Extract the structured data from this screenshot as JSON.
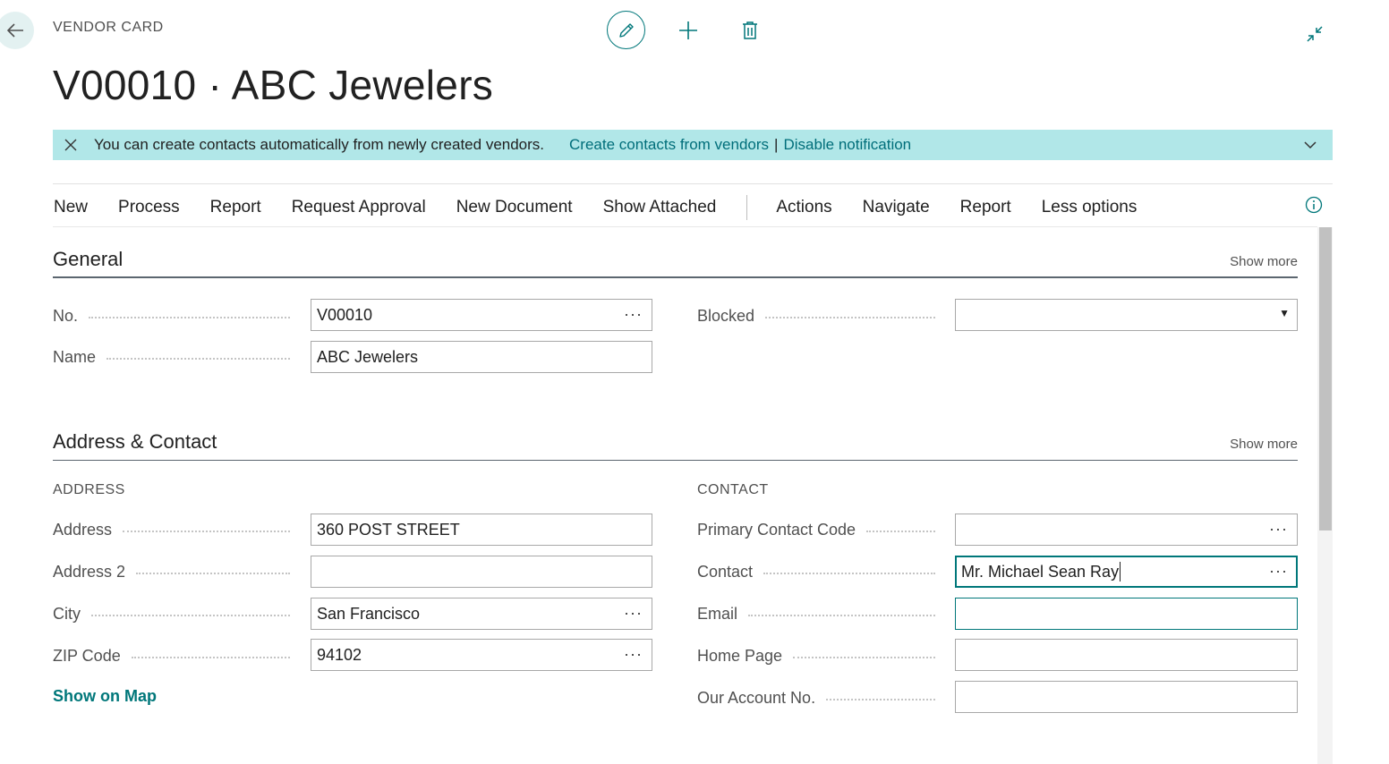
{
  "header": {
    "caption": "VENDOR CARD",
    "title": "V00010 · ABC Jewelers"
  },
  "notification": {
    "message": "You can create contacts automatically from newly created vendors.",
    "link_create": "Create contacts from vendors",
    "separator": "|",
    "link_disable": "Disable notification"
  },
  "actions": {
    "primary": [
      "New",
      "Process",
      "Report",
      "Request Approval",
      "New Document",
      "Show Attached"
    ],
    "secondary": [
      "Actions",
      "Navigate",
      "Report",
      "Less options"
    ]
  },
  "general": {
    "title": "General",
    "show_more": "Show more",
    "no_label": "No.",
    "no_value": "V00010",
    "name_label": "Name",
    "name_value": "ABC Jewelers",
    "blocked_label": "Blocked",
    "blocked_value": ""
  },
  "address_contact": {
    "title": "Address & Contact",
    "show_more": "Show more",
    "address_caption": "ADDRESS",
    "contact_caption": "CONTACT",
    "address_label": "Address",
    "address_value": "360 POST STREET",
    "address2_label": "Address 2",
    "address2_value": "",
    "city_label": "City",
    "city_value": "San Francisco",
    "zip_label": "ZIP Code",
    "zip_value": "94102",
    "show_on_map": "Show on Map",
    "primary_contact_label": "Primary Contact Code",
    "primary_contact_value": "",
    "contact_label": "Contact",
    "contact_value": "Mr. Michael Sean Ray",
    "email_label": "Email",
    "email_value": "",
    "home_page_label": "Home Page",
    "home_page_value": "",
    "our_account_label": "Our Account No.",
    "our_account_value": ""
  },
  "ellipsis": "···",
  "dropdown_caret": "▼",
  "colors": {
    "accent": "#00777a",
    "notification_bg": "#b1e7e8",
    "link": "#006e7a"
  },
  "icons": [
    "back-arrow-icon",
    "pencil-icon",
    "plus-icon",
    "trash-icon",
    "collapse-icon",
    "close-icon",
    "chevron-down-icon",
    "info-icon"
  ]
}
